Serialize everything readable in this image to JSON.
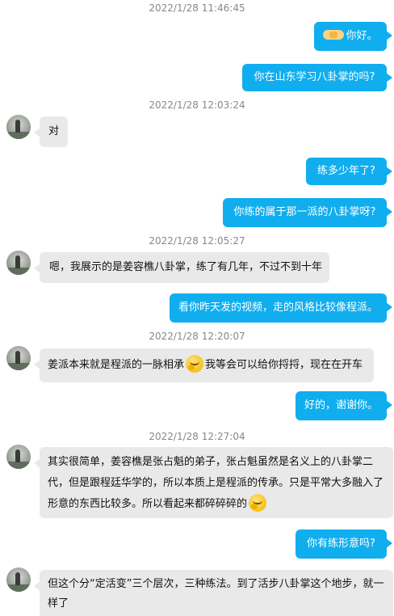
{
  "timestamps": [
    "2022/1/28 11:46:45",
    "2022/1/28 12:03:24",
    "2022/1/28 12:05:27",
    "2022/1/28 12:20:07",
    "2022/1/28 12:27:04"
  ],
  "messages": {
    "m1": "你好。",
    "m2": "你在山东学习八卦掌的吗?",
    "m3": "对",
    "m4": "练多少年了?",
    "m5": "你练的属于那一派的八卦掌呀?",
    "m6": "嗯，我展示的是姜容樵八卦掌，练了有几年，不过不到十年",
    "m7": "看你昨天发的视频，走的风格比较像程派。",
    "m8a": "姜派本来就是程派的一脉相承",
    "m8b": "我等会可以给你捋捋，现在在开车",
    "m9": "好的，谢谢你。",
    "m10a": "其实很简单，姜容樵是张占魁的弟子，张占魁虽然是名义上的八卦掌二代，但是跟程廷华学的，所以本质上是程派的传承。只是平常大多融入了形意的东西比较多。所以看起来都碎碎碎的",
    "m11": "你有练形意吗?",
    "m12": "但这个分“定活变”三个层次，三种练法。到了活步八卦掌这个地步，就一样了"
  },
  "icons": {
    "handshake": "handshake-emoji",
    "pensive": "pensive-face-emoji",
    "avatar": "contact-avatar"
  },
  "colors": {
    "outgoing_bubble": "#10aeef",
    "incoming_bubble": "#e9e9e9",
    "timestamp": "#888888"
  }
}
